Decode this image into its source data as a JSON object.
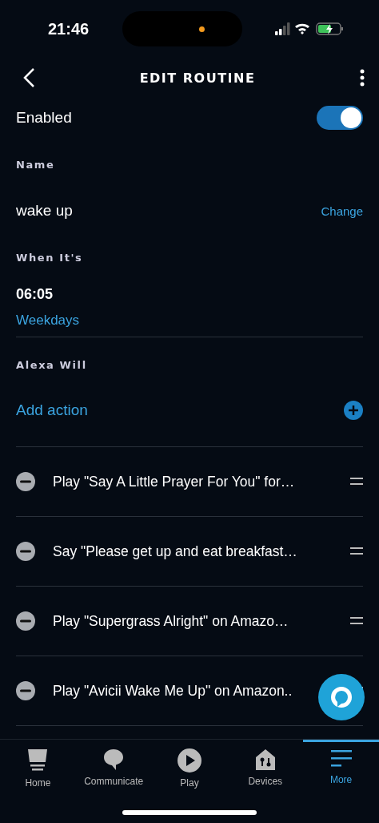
{
  "status_bar": {
    "time": "21:46"
  },
  "header": {
    "title": "EDIT ROUTINE"
  },
  "enabled": {
    "label": "Enabled",
    "on": true
  },
  "name": {
    "label": "Name",
    "value": "wake up",
    "action": "Change"
  },
  "when": {
    "label": "When It's",
    "time": "06:05",
    "days": "Weekdays"
  },
  "alexa_will": {
    "label": "Alexa Will",
    "add_label": "Add action"
  },
  "actions": [
    {
      "text": "Play \"Say A Little Prayer For You\" for…"
    },
    {
      "text": "Say \"Please get up and eat breakfast…"
    },
    {
      "text": "Play \"Supergrass Alright\" on Amazo…"
    },
    {
      "text": "Play \"Avicii Wake Me Up\" on Amazon.."
    }
  ],
  "tab_bar": [
    {
      "label": "Home",
      "kind": "home",
      "selected": false
    },
    {
      "label": "Communicate",
      "kind": "chat",
      "selected": false
    },
    {
      "label": "Play",
      "kind": "play",
      "selected": false
    },
    {
      "label": "Devices",
      "kind": "devices",
      "selected": false
    },
    {
      "label": "More",
      "kind": "menu",
      "selected": true
    }
  ]
}
